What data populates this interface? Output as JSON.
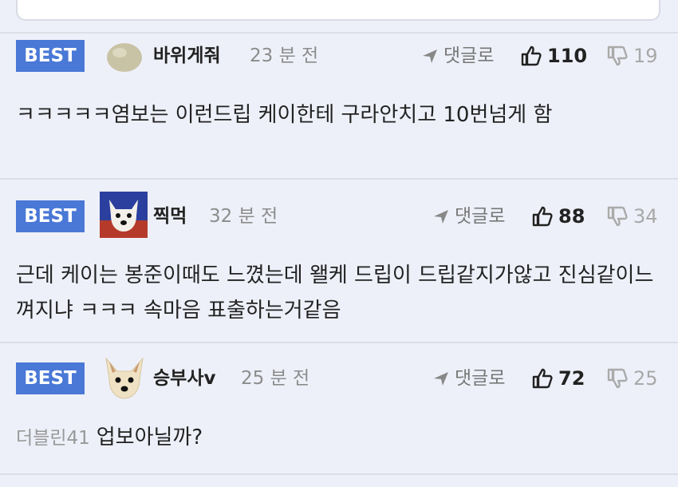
{
  "comments": [
    {
      "badge": "BEST",
      "nickname": "바위게줘",
      "time": "23 분 전",
      "reply_label": "댓글로",
      "likes": "110",
      "dislikes": "19",
      "text": "ㅋㅋㅋㅋㅋ염보는 이런드립 케이한테 구라안치고 10번넘게 함"
    },
    {
      "badge": "BEST",
      "nickname": "찍먹",
      "time": "32 분 전",
      "reply_label": "댓글로",
      "likes": "88",
      "dislikes": "34",
      "text": "근데 케이는 봉준이때도 느꼈는데 왤케 드립이 드립같지가않고 진심같이느껴지냐 ㅋㅋㅋ 속마음 표출하는거같음"
    },
    {
      "badge": "BEST",
      "nickname": "승부사v",
      "time": "25 분 전",
      "reply_label": "댓글로",
      "likes": "72",
      "dislikes": "25",
      "reply_to": "더블린41",
      "text": "업보아닐까?"
    }
  ],
  "colors": {
    "badge": "#4a78d6",
    "background": "#eef0f9"
  },
  "icons": {
    "reply": "send-arrow-icon",
    "like": "thumbs-up-icon",
    "dislike": "thumbs-down-icon"
  }
}
